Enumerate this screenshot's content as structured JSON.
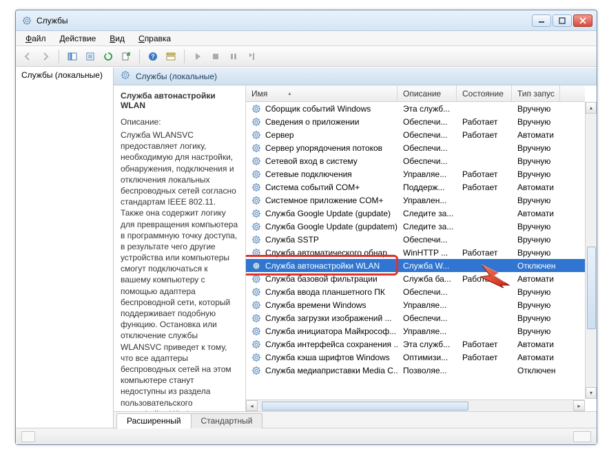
{
  "window": {
    "title": "Службы"
  },
  "menu": {
    "file": "Файл",
    "action": "Действие",
    "view": "Вид",
    "help": "Справка"
  },
  "left": {
    "node": "Службы (локальные)"
  },
  "pane": {
    "header": "Службы (локальные)"
  },
  "details": {
    "title": "Служба автонастройки WLAN",
    "desc_label": "Описание:",
    "desc_text": "Служба WLANSVC предоставляет логику, необходимую для настройки, обнаружения, подключения и отключения локальных беспроводных сетей согласно стандартам IEEE 802.11. Также она содержит логику для превращения компьютера в программную точку доступа, в результате чего другие устройства или компьютеры смогут подключаться к вашему компьютеру с помощью адаптера беспроводной сети, который поддерживает подобную функцию. Остановка или отключение службы WLANSVC приведет к тому, что все адаптеры беспроводных сетей на этом компьютере станут недоступны из раздела пользовательского интерфейса Windows, отвечающего за управление сетью. Настоятельно рекомендуется"
  },
  "columns": {
    "name": "Имя",
    "desc": "Описание",
    "state": "Состояние",
    "startup": "Тип запус"
  },
  "services": [
    {
      "name": "Сборщик событий Windows",
      "desc": "Эта служб...",
      "state": "",
      "startup": "Вручную"
    },
    {
      "name": "Сведения о приложении",
      "desc": "Обеспечи...",
      "state": "Работает",
      "startup": "Вручную"
    },
    {
      "name": "Сервер",
      "desc": "Обеспечи...",
      "state": "Работает",
      "startup": "Автомати"
    },
    {
      "name": "Сервер упорядочения потоков",
      "desc": "Обеспечи...",
      "state": "",
      "startup": "Вручную"
    },
    {
      "name": "Сетевой вход в систему",
      "desc": "Обеспечи...",
      "state": "",
      "startup": "Вручную"
    },
    {
      "name": "Сетевые подключения",
      "desc": "Управляе...",
      "state": "Работает",
      "startup": "Вручную"
    },
    {
      "name": "Система событий COM+",
      "desc": "Поддерж...",
      "state": "Работает",
      "startup": "Автомати"
    },
    {
      "name": "Системное приложение COM+",
      "desc": "Управлен...",
      "state": "",
      "startup": "Вручную"
    },
    {
      "name": "Служба Google Update (gupdate)",
      "desc": "Следите за...",
      "state": "",
      "startup": "Автомати"
    },
    {
      "name": "Служба Google Update (gupdatem)",
      "desc": "Следите за...",
      "state": "",
      "startup": "Вручную"
    },
    {
      "name": "Служба SSTP",
      "desc": "Обеспечи...",
      "state": "",
      "startup": "Вручную"
    },
    {
      "name": "Служба автоматического обнар...",
      "desc": "WinHTTP ...",
      "state": "Работает",
      "startup": "Вручную"
    },
    {
      "name": "Служба автонастройки WLAN",
      "desc": "Служба W...",
      "state": "",
      "startup": "Отключен",
      "selected": true
    },
    {
      "name": "Служба базовой фильтрации",
      "desc": "Служба ба...",
      "state": "Работает",
      "startup": "Автомати"
    },
    {
      "name": "Служба ввода планшетного ПК",
      "desc": "Обеспечи...",
      "state": "",
      "startup": "Вручную"
    },
    {
      "name": "Служба времени Windows",
      "desc": "Управляе...",
      "state": "",
      "startup": "Вручную"
    },
    {
      "name": "Служба загрузки изображений ...",
      "desc": "Обеспечи...",
      "state": "",
      "startup": "Вручную"
    },
    {
      "name": "Служба инициатора Майкрософ...",
      "desc": "Управляе...",
      "state": "",
      "startup": "Вручную"
    },
    {
      "name": "Служба интерфейса сохранения ...",
      "desc": "Эта служб...",
      "state": "Работает",
      "startup": "Автомати"
    },
    {
      "name": "Служба кэша шрифтов Windows",
      "desc": "Оптимизи...",
      "state": "Работает",
      "startup": "Автомати"
    },
    {
      "name": "Служба медиаприставки Media C...",
      "desc": "Позволяе...",
      "state": "",
      "startup": "Отключен"
    }
  ],
  "tabs": {
    "extended": "Расширенный",
    "standard": "Стандартный"
  }
}
